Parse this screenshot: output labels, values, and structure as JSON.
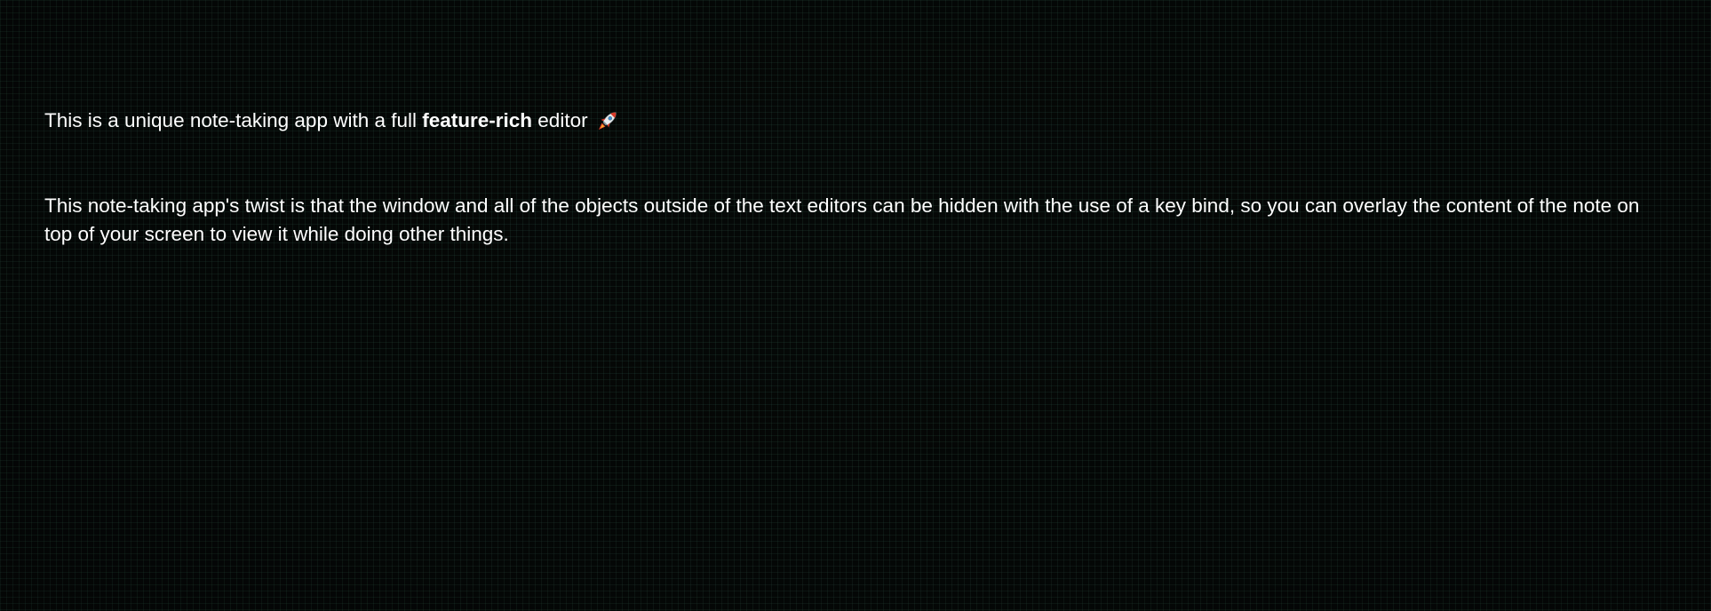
{
  "note": {
    "paragraph1": {
      "before": "This is a unique note-taking app with a full ",
      "bold": "feature-rich",
      "after": " editor ",
      "emoji_icon": "rocket-icon"
    },
    "paragraph2": "This note-taking app's twist is that the window and all of the objects outside of the text editors can be hidden with the use of a key bind, so you can overlay the content of the note on top of your screen to view it while doing other things."
  },
  "colors": {
    "background": "#050807",
    "grid": "#1f3a30",
    "text": "#ffffff"
  }
}
